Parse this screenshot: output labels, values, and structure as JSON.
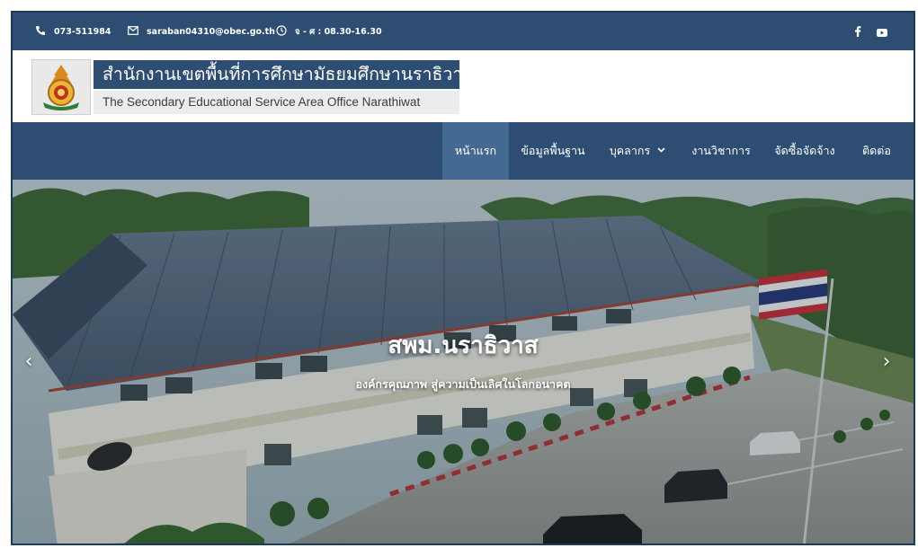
{
  "topbar": {
    "phone": "073-511984",
    "email": "saraban04310@obec.go.th",
    "hours": "จ - ศ : 08.30-16.30",
    "icons": {
      "phone": "phone-icon",
      "email": "envelope-icon",
      "hours": "clock-icon",
      "facebook": "facebook-icon",
      "youtube": "youtube-icon"
    }
  },
  "header": {
    "name_th": "สำนักงานเขตพื้นที่การศึกษามัธยมศึกษานราธิวาส",
    "name_en": "The Secondary Educational Service Area Office Narathiwat"
  },
  "nav": {
    "items": [
      {
        "label": "หน้าแรก",
        "active": true
      },
      {
        "label": "ข้อมูลพื้นฐาน"
      },
      {
        "label": "บุคลากร",
        "has_dropdown": true
      },
      {
        "label": "งานวิชาการ"
      },
      {
        "label": "จัดซื้อจัดจ้าง"
      },
      {
        "label": "ติดต่อ"
      }
    ]
  },
  "hero": {
    "title": "สพม.นราธิวาส",
    "subtitle": "องค์กรคุณภาพ สู่ความเป็นเลิศในโลกอนาคต",
    "prev_arrow": "‹",
    "next_arrow": "›"
  },
  "colors": {
    "brand_navy": "#2d4e72",
    "nav_active": "#446a92",
    "white": "#ffffff"
  }
}
